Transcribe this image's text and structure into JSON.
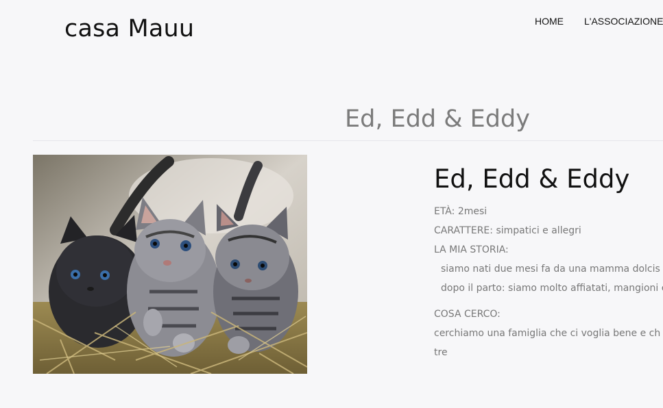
{
  "header": {
    "logo": "casa Mauu",
    "nav": [
      "HOME",
      "L'ASSOCIAZIONE"
    ]
  },
  "page": {
    "title": "Ed, Edd & Eddy"
  },
  "profile": {
    "name": "Ed, Edd & Eddy",
    "age_label": "ETÀ:",
    "age_value": "2mesi",
    "character_label": "CARATTERE:",
    "character_value": "simpatici e allegri",
    "story_label": "LA MIA STORIA:",
    "story_lines": [
      "siamo nati due mesi fa da una mamma dolcis",
      "dopo il parto: siamo molto affiatati, mangioni e"
    ],
    "seeking_label": "COSA CERCO:",
    "seeking_lines": [
      "cerchiamo una famiglia che ci voglia bene e ch",
      "tre"
    ]
  }
}
